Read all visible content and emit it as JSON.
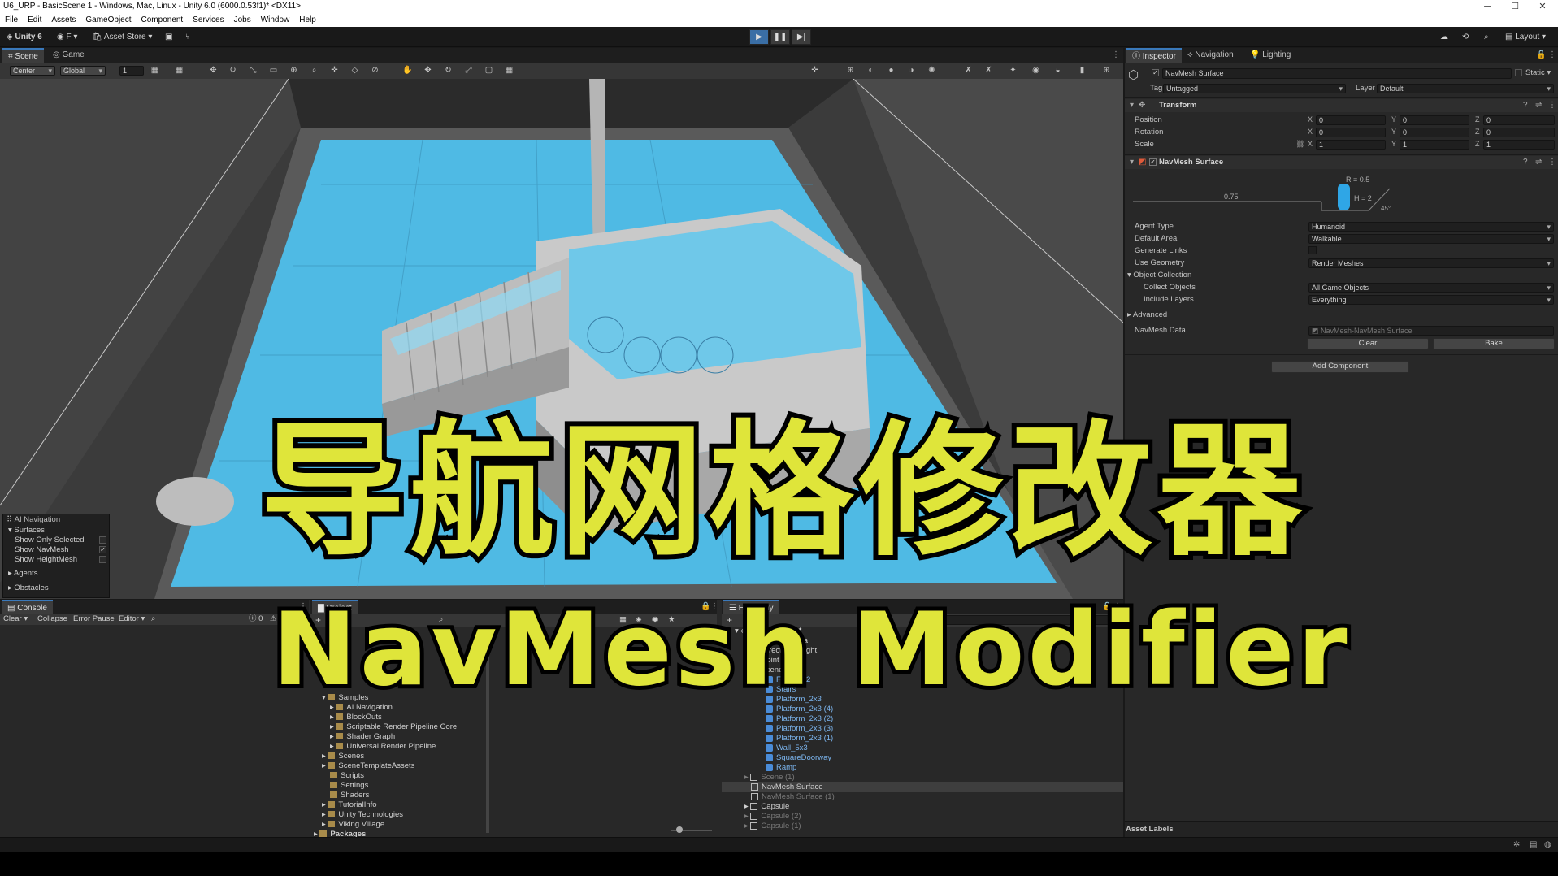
{
  "window": {
    "title": "U6_URP - BasicScene 1 - Windows, Mac, Linux - Unity 6.0 (6000.0.53f1)* <DX11>",
    "minimize": "─",
    "maximize": "☐",
    "close": "✕"
  },
  "menu": [
    "File",
    "Edit",
    "Assets",
    "GameObject",
    "Component",
    "Services",
    "Jobs",
    "Window",
    "Help"
  ],
  "toolbar": {
    "logo": "Unity 6",
    "account": "F",
    "asset_store": "Asset Store",
    "layout": "Layout"
  },
  "scene_tabs": {
    "scene": "Scene",
    "game": "Game"
  },
  "scene_toolbar": {
    "pivot": "Center",
    "space": "Global",
    "snap": "1"
  },
  "ai_overlay": {
    "title": "AI Navigation",
    "surfaces": "Surfaces",
    "items": [
      {
        "label": "Show Only Selected",
        "checked": false
      },
      {
        "label": "Show NavMesh",
        "checked": true
      },
      {
        "label": "Show HeightMesh",
        "checked": false
      }
    ],
    "agents": "Agents",
    "obstacles": "Obstacles"
  },
  "inspector_tabs": {
    "inspector": "Inspector",
    "navigation": "Navigation",
    "lighting": "Lighting"
  },
  "inspector": {
    "object_name": "NavMesh Surface",
    "static": "Static",
    "tag_label": "Tag",
    "tag_value": "Untagged",
    "layer_label": "Layer",
    "layer_value": "Default",
    "transform": {
      "title": "Transform",
      "rows": [
        {
          "label": "Position",
          "x": "0",
          "y": "0",
          "z": "0"
        },
        {
          "label": "Rotation",
          "x": "0",
          "y": "0",
          "z": "0"
        },
        {
          "label": "Scale",
          "x": "1",
          "y": "1",
          "z": "1"
        }
      ]
    },
    "navmesh_surface": {
      "title": "NavMesh Surface",
      "diagram": {
        "radius": "R = 0.5",
        "height": "H = 2",
        "step": "0.75",
        "slope": "45°"
      },
      "agent_type_label": "Agent Type",
      "agent_type": "Humanoid",
      "default_area_label": "Default Area",
      "default_area": "Walkable",
      "generate_links_label": "Generate Links",
      "use_geometry_label": "Use Geometry",
      "use_geometry": "Render Meshes",
      "object_collection_label": "Object Collection",
      "collect_objects_label": "Collect Objects",
      "collect_objects": "All Game Objects",
      "include_layers_label": "Include Layers",
      "include_layers": "Everything",
      "advanced_label": "Advanced",
      "navmesh_data_label": "NavMesh Data",
      "navmesh_data": "NavMesh-NavMesh Surface",
      "clear": "Clear",
      "bake": "Bake"
    },
    "add_component": "Add Component",
    "asset_labels": "Asset Labels"
  },
  "console": {
    "tab": "Console",
    "clear": "Clear",
    "collapse": "Collapse",
    "error_pause": "Error Pause",
    "editor": "Editor",
    "count": "0"
  },
  "project": {
    "tab": "Project",
    "tree": [
      {
        "label": "Samples",
        "indent": 1,
        "open": true
      },
      {
        "label": "AI Navigation",
        "indent": 2
      },
      {
        "label": "BlockOuts",
        "indent": 2
      },
      {
        "label": "Scriptable Render Pipeline Core",
        "indent": 2
      },
      {
        "label": "Shader Graph",
        "indent": 2
      },
      {
        "label": "Universal Render Pipeline",
        "indent": 2
      },
      {
        "label": "Scenes",
        "indent": 1
      },
      {
        "label": "SceneTemplateAssets",
        "indent": 1
      },
      {
        "label": "Scripts",
        "indent": 1
      },
      {
        "label": "Settings",
        "indent": 1
      },
      {
        "label": "Shaders",
        "indent": 1
      },
      {
        "label": "TutorialInfo",
        "indent": 1
      },
      {
        "label": "Unity Technologies",
        "indent": 1
      },
      {
        "label": "Viking Village",
        "indent": 1
      },
      {
        "label": "Packages",
        "indent": 0
      }
    ]
  },
  "hierarchy": {
    "tab": "Hierarchy",
    "search": "All",
    "scene": "BasicScene 1*",
    "items": [
      {
        "label": "Main Camera",
        "kind": "go",
        "indent": 2
      },
      {
        "label": "Directional Light",
        "kind": "go",
        "indent": 2
      },
      {
        "label": "Point Light",
        "kind": "go",
        "indent": 2
      },
      {
        "label": "Scene",
        "kind": "go",
        "indent": 2
      },
      {
        "label": "Floor_2x2",
        "kind": "prefab",
        "indent": 3
      },
      {
        "label": "Stairs",
        "kind": "prefab",
        "indent": 3
      },
      {
        "label": "Platform_2x3",
        "kind": "prefab",
        "indent": 3
      },
      {
        "label": "Platform_2x3 (4)",
        "kind": "prefab",
        "indent": 3
      },
      {
        "label": "Platform_2x3 (2)",
        "kind": "prefab",
        "indent": 3
      },
      {
        "label": "Platform_2x3 (3)",
        "kind": "prefab",
        "indent": 3
      },
      {
        "label": "Platform_2x3 (1)",
        "kind": "prefab",
        "indent": 3
      },
      {
        "label": "Wall_5x3",
        "kind": "prefab",
        "indent": 3
      },
      {
        "label": "SquareDoorway",
        "kind": "prefab",
        "indent": 3
      },
      {
        "label": "Ramp",
        "kind": "prefab",
        "indent": 3
      },
      {
        "label": "Scene (1)",
        "kind": "dim",
        "indent": 2
      },
      {
        "label": "NavMesh Surface",
        "kind": "selected",
        "indent": 2
      },
      {
        "label": "NavMesh Surface (1)",
        "kind": "dim",
        "indent": 2
      },
      {
        "label": "Capsule",
        "kind": "go",
        "indent": 2
      },
      {
        "label": "Capsule (2)",
        "kind": "dim",
        "indent": 2
      },
      {
        "label": "Capsule (1)",
        "kind": "dim",
        "indent": 2
      }
    ]
  },
  "overlay_text": {
    "chinese": "导航网格修改器",
    "english": "NavMesh Modifier"
  },
  "colors": {
    "navmesh": "#4fc0ec",
    "accent": "#3a79bb",
    "title_text": "#dfe53a"
  }
}
